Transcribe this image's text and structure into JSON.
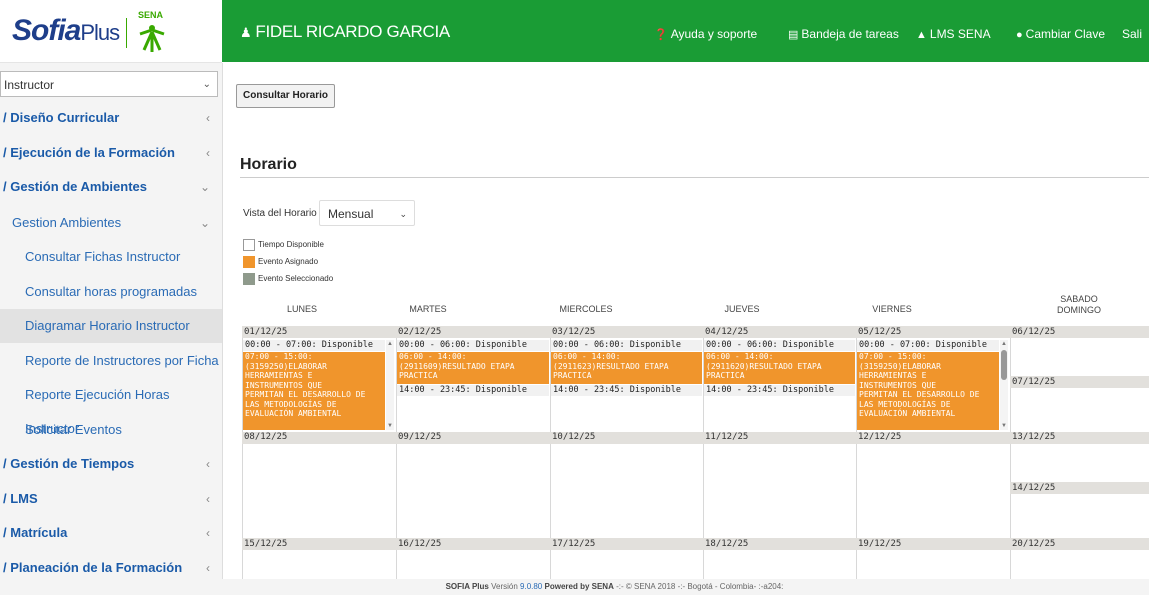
{
  "brand": {
    "logo_main": "Sofia",
    "logo_plus": "Plus",
    "sena_label": "SENA"
  },
  "header": {
    "user": "FIDEL RICARDO GARCIA",
    "links": [
      {
        "label": "Ayuda y soporte",
        "icon": "question-circle-icon"
      },
      {
        "label": "Bandeja de tareas",
        "icon": "tray-icon"
      },
      {
        "label": "LMS SENA",
        "icon": "graduation-cap-icon"
      },
      {
        "label": "Cambiar Clave",
        "icon": "lock-icon"
      },
      {
        "label": "Sali",
        "icon": ""
      }
    ]
  },
  "sidebar": {
    "role": "Instructor",
    "items": [
      {
        "label": "Diseño Curricular"
      },
      {
        "label": "Ejecución de la Formación"
      },
      {
        "label": "Gestión de Ambientes"
      },
      {
        "label": "Gestion Ambientes"
      },
      {
        "label": "Consultar Fichas Instructor"
      },
      {
        "label": "Consultar horas programadas"
      },
      {
        "label": "Diagramar Horario Instructor"
      },
      {
        "label": "Reporte de Instructores por Ficha"
      },
      {
        "label": "Reporte Ejecución Horas Instructor"
      },
      {
        "label": "Solicitar Eventos"
      },
      {
        "label": "Gestión de Tiempos"
      },
      {
        "label": "LMS"
      },
      {
        "label": "Matrícula"
      },
      {
        "label": "Planeación de la Formación"
      }
    ]
  },
  "main": {
    "consultar_button": "Consultar Horario",
    "title": "Horario",
    "vista_label": "Vista del Horario",
    "vista_value": "Mensual",
    "legend": [
      {
        "label": "Tiempo Disponible",
        "color": "#ffffff"
      },
      {
        "label": "Evento Asignado",
        "color": "#f0952c"
      },
      {
        "label": "Evento Seleccionado",
        "color": "#8f9a8c"
      }
    ]
  },
  "calendar": {
    "days": [
      "LUNES",
      "MARTES",
      "MIERCOLES",
      "JUEVES",
      "VIERNES",
      "SABADO",
      "DOMINGO"
    ],
    "week1": {
      "dates": [
        "01/12/25",
        "02/12/25",
        "03/12/25",
        "04/12/25",
        "05/12/25",
        "06/12/25",
        "07/12/25"
      ],
      "mon_avail": "00:00 - 07:00: Disponible",
      "mon_event": "07:00 - 15:00:\n(3159250)ELABORAR\nHERRAMIENTAS E\nINSTRUMENTOS QUE\nPERMITAN EL DESARROLLO DE\nLAS METODOLOGÍAS DE\nEVALUACIÓN AMBIENTAL",
      "tue_avail1": "00:00 - 06:00: Disponible",
      "tue_event": "06:00 - 14:00:\n(2911609)RESULTADO ETAPA\nPRACTICA",
      "tue_avail2": "14:00 - 23:45: Disponible",
      "wed_avail1": "00:00 - 06:00: Disponible",
      "wed_event": "06:00 - 14:00:\n(2911623)RESULTADO ETAPA\nPRACTICA",
      "wed_avail2": "14:00 - 23:45: Disponible",
      "thu_avail1": "00:00 - 06:00: Disponible",
      "thu_event": "06:00 - 14:00:\n(2911620)RESULTADO ETAPA\nPRACTICA",
      "thu_avail2": "14:00 - 23:45: Disponible",
      "fri_avail": "00:00 - 07:00: Disponible",
      "fri_event": "07:00 - 15:00:\n(3159250)ELABORAR\nHERRAMIENTAS E\nINSTRUMENTOS QUE\nPERMITAN EL DESARROLLO DE\nLAS METODOLOGÍAS DE\nEVALUACIÓN AMBIENTAL"
    },
    "week2": {
      "dates": [
        "08/12/25",
        "09/12/25",
        "10/12/25",
        "11/12/25",
        "12/12/25",
        "13/12/25",
        "14/12/25"
      ]
    },
    "week3": {
      "dates": [
        "15/12/25",
        "16/12/25",
        "17/12/25",
        "18/12/25",
        "19/12/25",
        "20/12/25"
      ]
    }
  },
  "footer": {
    "brand": "SOFIA Plus",
    "version_label": "Versión",
    "version": "9.0.80",
    "powered": "Powered by SENA",
    "rest": "-:- © SENA 2018 -:- Bogotá - Colombia- :-a204:"
  }
}
